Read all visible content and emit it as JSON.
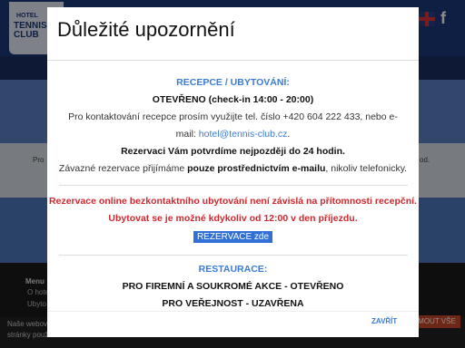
{
  "background": {
    "logo_small": "HOTEL",
    "logo_main": "TENNIS CLUB",
    "facebook_icon": "f",
    "left_text": "Pro",
    "right_text": "od.",
    "menu_title": "Menu",
    "footer_line1": "O hote",
    "footer_line2": "Ubyto",
    "cookie_text1": "Naše webov",
    "cookie_text2": "stránky použí",
    "cookie_button": "MOUT VŠE"
  },
  "modal": {
    "title": "Důležité upozornění",
    "reception": {
      "heading": "RECEPCE / UBYTOVÁNÍ:",
      "status": "OTEVŘENO (check-in 14:00 - 20:00)",
      "contact_line1": "Pro kontaktování recepce prosím využijte tel. číslo +420 604 222 433, nebo e-",
      "contact_prefix": "mail: ",
      "email": "hotel@tennis-club.cz",
      "contact_suffix": ".",
      "confirm": "Rezervaci Vám potvrdíme nejpozději do 24 hodin.",
      "binding_prefix": "Závazné rezervace přijímáme ",
      "binding_bold": "pouze prostřednictvím e-mailu",
      "binding_suffix": ", nikoliv telefonicky."
    },
    "notice_line1": "Rezervace online bezkontaktního ubytování není závislá na přítomnosti recepční.",
    "notice_line2": "Ubytovat se je možné kdykoliv od 12:00 v den příjezdu.",
    "reserve_button": "REZERVACE zde",
    "restaurant": {
      "heading": "RESTAURACE:",
      "line1": "PRO FIREMNÍ A SOUKROMÉ AKCE - OTEVŘENO",
      "line2": "PRO VEŘEJNOST - UZAVŘENA"
    },
    "close_button": "ZAVŘÍT"
  },
  "colors": {
    "accent_blue": "#3a7bd5",
    "alert_red": "#d0282f",
    "header_navy": "#1d3a7a"
  }
}
